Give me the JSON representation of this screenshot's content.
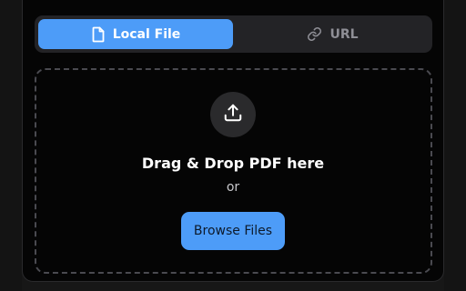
{
  "tabs": {
    "local_file": {
      "label": "Local File",
      "icon": "file-icon",
      "active": true
    },
    "url": {
      "label": "URL",
      "icon": "link-icon",
      "active": false
    }
  },
  "dropzone": {
    "icon": "upload-icon",
    "title": "Drag & Drop PDF here",
    "or_text": "or",
    "browse_label": "Browse Files"
  },
  "colors": {
    "accent": "#4d9cf8",
    "panel_bg": "#050505",
    "tab_bar_bg": "#232326",
    "inactive_text": "#8f8f96"
  }
}
